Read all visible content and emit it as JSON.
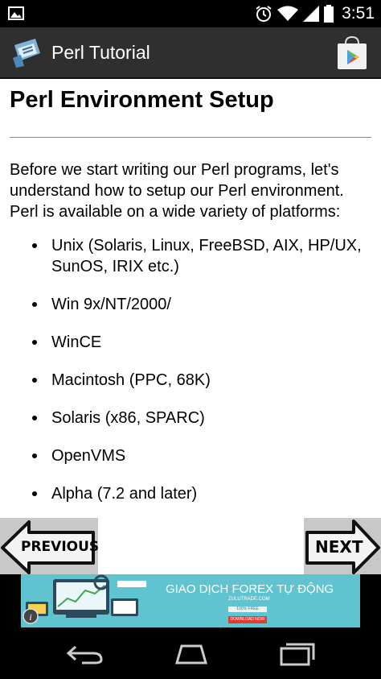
{
  "status_bar": {
    "time": "3:51",
    "icons": [
      "gallery-icon",
      "alarm-icon",
      "wifi-icon",
      "signal-icon",
      "battery-icon"
    ]
  },
  "action_bar": {
    "title": "Perl Tutorial",
    "app_icon": "perl-app-icon",
    "store_icon": "play-store-icon"
  },
  "content": {
    "title": "Perl Environment Setup",
    "intro": "Before we start writing our Perl programs, let's understand how to setup our Perl environment. Perl is available on a wide variety of platforms:",
    "platforms": [
      "Unix (Solaris, Linux, FreeBSD, AIX, HP/UX, SunOS, IRIX etc.)",
      "Win 9x/NT/2000/",
      "WinCE",
      "Macintosh (PPC, 68K)",
      "Solaris (x86, SPARC)",
      "OpenVMS",
      "Alpha (7.2 and later)"
    ]
  },
  "nav": {
    "previous_label": "PREVIOUS",
    "next_label": "NEXT"
  },
  "ad": {
    "headline": "GIAO DỊCH FOREX TỰ ĐỘNG",
    "sub": "ZULUTRADE.COM",
    "button1": "100% FREE",
    "button2": "DOWNLOAD NOW"
  },
  "colors": {
    "status_bar": "#000000",
    "action_bar": "#2f2f2f",
    "ad_background": "#5fc4cf",
    "nav_button": "#c8c8c8"
  }
}
